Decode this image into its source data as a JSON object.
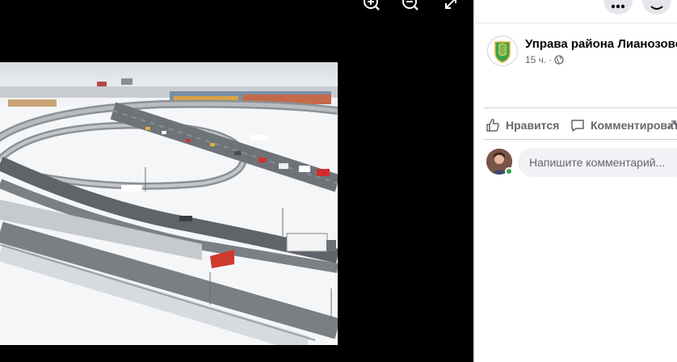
{
  "viewer": {
    "controls": [
      {
        "name": "zoom-in-icon"
      },
      {
        "name": "zoom-out-icon"
      },
      {
        "name": "fullscreen-icon"
      }
    ],
    "photo": {
      "subject": "highway-interchange-snow"
    }
  },
  "post": {
    "page_name": "Управа района Лианозово",
    "time": "15 ч.",
    "separator": "·",
    "privacy_icon": "globe-icon"
  },
  "actions": {
    "like_label": "Нравится",
    "comment_label": "Комментировать",
    "share_icon": "share-icon"
  },
  "comment": {
    "placeholder": "Напишите комментарий..."
  },
  "colors": {
    "viewer_bg": "#000000",
    "secondary_text": "#65676b",
    "online": "#31a24c"
  }
}
